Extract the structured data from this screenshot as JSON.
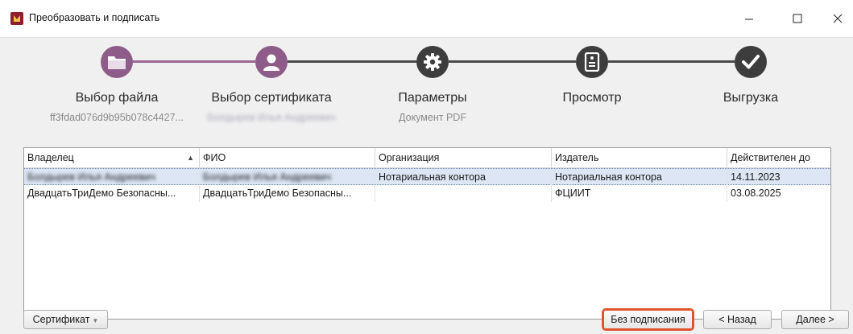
{
  "window": {
    "title": "Преобразовать и подписать",
    "controls": [
      "minimize-icon",
      "maximize-icon",
      "close-icon"
    ]
  },
  "stepper": {
    "steps": [
      {
        "label": "Выбор файла",
        "sub": "ff3fdad076d9b95b078c4427...",
        "icon": "folder-icon",
        "state": "done"
      },
      {
        "label": "Выбор сертификата",
        "sub": "Болдырев Илья Андреевич",
        "icon": "user-icon",
        "state": "active"
      },
      {
        "label": "Параметры",
        "sub": "Документ PDF",
        "icon": "gear-icon",
        "state": "pending"
      },
      {
        "label": "Просмотр",
        "sub": "",
        "icon": "document-icon",
        "state": "pending"
      },
      {
        "label": "Выгрузка",
        "sub": "",
        "icon": "checkmark-icon",
        "state": "pending"
      }
    ]
  },
  "table": {
    "columns": [
      "Владелец",
      "ФИО",
      "Организация",
      "Издатель",
      "Действителен до"
    ],
    "sorted_column": "Владелец",
    "rows": [
      [
        "Болдырев Илья Андреевич",
        "Болдырев Илья Андреевич",
        "Нотариальная контора",
        "Нотариальная контора",
        "14.11.2023"
      ],
      [
        "ДвадцатьТриДемо Безопасны...",
        "ДвадцатьТриДемо Безопасны...",
        "",
        "ФЦИИТ",
        "03.08.2025"
      ]
    ],
    "selected_row": 0
  },
  "footer": {
    "certificate_button": "Сертификат",
    "no_sign_button": "Без подписания",
    "back_button": "< Назад",
    "next_button": "Далее >"
  },
  "colors": {
    "active_step": "#8e5c88",
    "pending_step": "#3d3d3d",
    "highlight": "#e0542c",
    "selection": "#dce6f5"
  }
}
